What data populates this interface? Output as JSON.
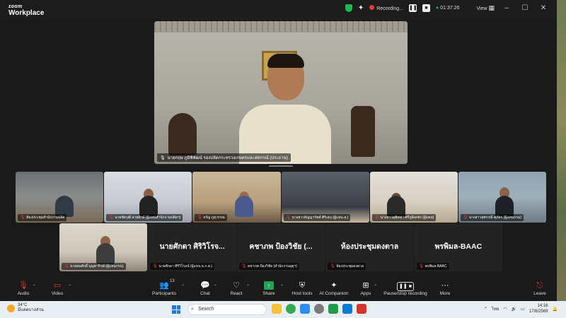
{
  "app": {
    "logo_top": "zoom",
    "logo_bottom": "Workplace"
  },
  "titlebar": {
    "recording_label": "Recording...",
    "timer": "01:37:26",
    "view_label": "View",
    "minimize": "–",
    "maximize": "☐",
    "close": "✕"
  },
  "main_video": {
    "caption": "นายกฤษ ภูมิพิพัฒน์ รองปลัดกระทรวงเกษตรและสหกรณ์ (ประธาน)"
  },
  "gallery_row1": [
    {
      "caption": "ห้องประชุมสำนักงานปลัด"
    },
    {
      "caption": "นายชัยวุฒิ สายยักษ์ (ผู้แทนสำนักงานปลัดฯ)"
    },
    {
      "caption": "จรัญ ภูสุวรรณ"
    },
    {
      "caption": "นางสาวธัญญารัชต์ ศิริเสน (ผู้แทน ส.)"
    },
    {
      "caption": "นางสาวสุพิชชา ศรีภูมิเดชร (ผู้แทน)"
    },
    {
      "caption": "นางสาวสุพรรณี ศุภัตร (ผู้แทนกรม)"
    }
  ],
  "gallery_row2": [
    {
      "caption": "นายสมศักดิ์ บุญทาริกษ์ (ผู้แทนกรม)",
      "name": ""
    },
    {
      "caption": "นายศักดา ศิริวิโรจน์ (ผู้แทน ธ.ก.ส.)",
      "name": "นายศักดา ศิริวิโรจ..."
    },
    {
      "caption": "คชาภพ ป้องวิชัย (สำนักงานอุตุฯ)",
      "name": "คชาภพ ป้องวิชัย (..."
    },
    {
      "caption": "ห้องประชุมดงตาล",
      "name": "ห้องประชุมดงตาล"
    },
    {
      "caption": "พรพิมล-BAAC",
      "name": "พรพิมล-BAAC"
    }
  ],
  "toolbar": {
    "audio": "Audio",
    "video": "Video",
    "participants": "Participants",
    "participants_count": "13",
    "chat": "Chat",
    "react": "React",
    "share": "Share",
    "host_tools": "Host tools",
    "ai_companion": "AI Companion",
    "apps": "Apps",
    "pause_stop": "Pause/stop recording",
    "more": "More",
    "leave": "Leave"
  },
  "taskbar": {
    "temp": "34°C",
    "weather": "มีแดดบางส่วน",
    "search": "Search",
    "lang": "ไทย",
    "time": "14:16",
    "date": "17/8/2569"
  },
  "colors": {
    "record_red": "#e53935",
    "share_green": "#23a455",
    "shield_green": "#1db954"
  }
}
